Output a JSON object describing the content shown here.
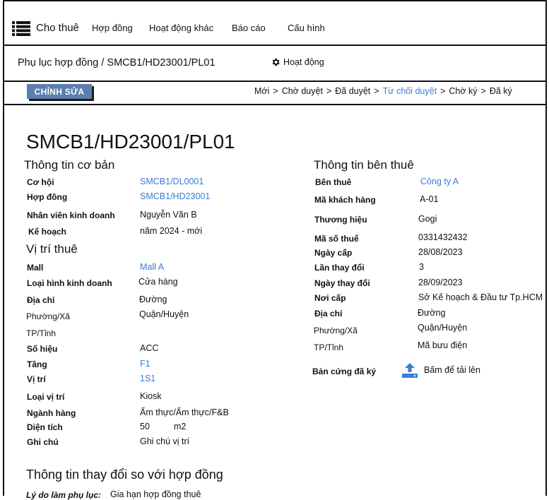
{
  "nav": {
    "brand": "Cho thuê",
    "items": [
      "Hợp đồng",
      "Hoạt động khác",
      "Báo cáo",
      "Cấu hình"
    ]
  },
  "breadcrumb": {
    "path": "Phụ lục hợp đồng / SMCB1/HD23001/PL01",
    "activity": "Hoạt động"
  },
  "toolbar": {
    "edit_label": "CHỈNH SỬA",
    "statuses": [
      "Mới",
      "Chờ duyệt",
      "Đã duyệt",
      "Từ chối duyệt",
      "Chờ ký",
      "Đã ký"
    ],
    "active_status": "Từ chối duyệt"
  },
  "record": {
    "title": "SMCB1/HD23001/PL01"
  },
  "basic": {
    "heading": "Thông tin cơ bản",
    "opportunity_label": "Cơ hội",
    "opportunity_value": "SMCB1/DL0001",
    "contract_label": "Hợp đồng",
    "contract_value": "SMCB1/HD23001",
    "sales_label": "Nhân viên kinh doanh",
    "sales_value": "Nguyễn Văn B",
    "plan_label": "Kế hoạch",
    "plan_value": "năm 2024 - mới"
  },
  "location": {
    "heading": "Vị trí thuê",
    "mall_label": "Mall",
    "mall_value": "Mall A",
    "biz_type_label": "Loại hình kinh doanh",
    "biz_type_value": "Cửa hàng",
    "address_label": "Địa chỉ",
    "address_value": "Đường",
    "ward_label": "Phường/Xã",
    "district_value": "Quận/Huyện",
    "province_label": "TP/Tỉnh",
    "number_label": "Số hiệu",
    "number_value": "ACC",
    "floor_label": "Tầng",
    "floor_value": "F1",
    "position_label": "Vị trí",
    "position_value": "1S1",
    "position_type_label": "Loại vị trí",
    "position_type_value": "Kiosk",
    "industry_label": "Ngành hàng",
    "industry_value": "Ẩm thực/Ẩm thực/F&B",
    "area_label": "Diện tích",
    "area_value": "50",
    "area_unit": "m2",
    "note_label": "Ghi chú",
    "note_value": "Ghi chú vị trí"
  },
  "tenant": {
    "heading": "Thông tin bên thuê",
    "tenant_label": "Bên thuê",
    "tenant_value": "Công ty A",
    "customer_code_label": "Mã khách hàng",
    "customer_code_value": "A-01",
    "brand_label": "Thương hiệu",
    "brand_value": "Gogi",
    "tax_code_label": "Mã số thuế",
    "tax_code_value": "0331432432",
    "issue_date_label": "Ngày cấp",
    "issue_date_value": "28/08/2023",
    "change_count_label": "Lần thay đổi",
    "change_count_value": "3",
    "change_date_label": "Ngày thay đổi",
    "change_date_value": "28/09/2023",
    "issue_place_label": "Nơi cấp",
    "issue_place_value": "Sở Kế hoạch & Đầu tư Tp.HCM",
    "address_label": "Địa chỉ",
    "address_value": "Đường",
    "ward_label": "Phường/Xã",
    "district_value": "Quận/Huyện",
    "province_label": "TP/Tỉnh",
    "postal_value": "Mã bưu điện",
    "signed_copy_label": "Bản cứng đã ký",
    "upload_label": "Bấm để tải lên"
  },
  "changes": {
    "heading": "Thông tin thay đổi so với hợp đồng",
    "reason_label": "Lý do làm phụ lục:",
    "reason_value": "Gia hạn hợp đồng thuê"
  },
  "colors": {
    "accent": "#3b7dd8",
    "button": "#5b7fae"
  }
}
